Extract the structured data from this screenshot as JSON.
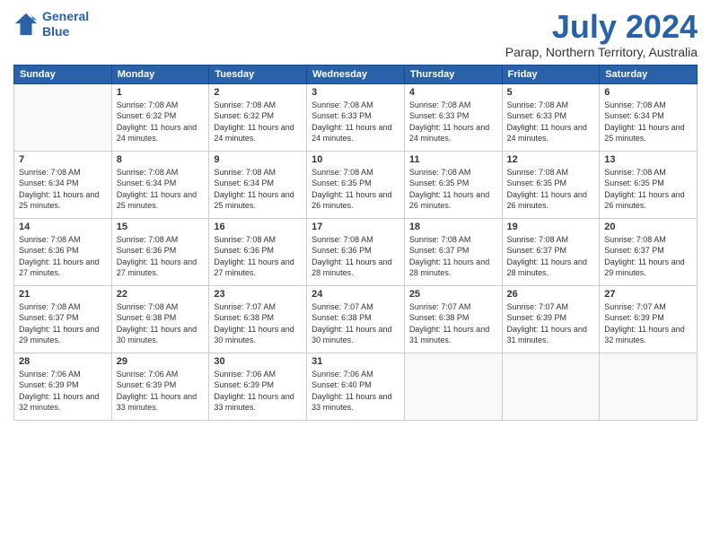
{
  "logo": {
    "line1": "General",
    "line2": "Blue"
  },
  "title": "July 2024",
  "subtitle": "Parap, Northern Territory, Australia",
  "days_header": [
    "Sunday",
    "Monday",
    "Tuesday",
    "Wednesday",
    "Thursday",
    "Friday",
    "Saturday"
  ],
  "weeks": [
    [
      {
        "day": "",
        "sunrise": "",
        "sunset": "",
        "daylight": ""
      },
      {
        "day": "1",
        "sunrise": "Sunrise: 7:08 AM",
        "sunset": "Sunset: 6:32 PM",
        "daylight": "Daylight: 11 hours and 24 minutes."
      },
      {
        "day": "2",
        "sunrise": "Sunrise: 7:08 AM",
        "sunset": "Sunset: 6:32 PM",
        "daylight": "Daylight: 11 hours and 24 minutes."
      },
      {
        "day": "3",
        "sunrise": "Sunrise: 7:08 AM",
        "sunset": "Sunset: 6:33 PM",
        "daylight": "Daylight: 11 hours and 24 minutes."
      },
      {
        "day": "4",
        "sunrise": "Sunrise: 7:08 AM",
        "sunset": "Sunset: 6:33 PM",
        "daylight": "Daylight: 11 hours and 24 minutes."
      },
      {
        "day": "5",
        "sunrise": "Sunrise: 7:08 AM",
        "sunset": "Sunset: 6:33 PM",
        "daylight": "Daylight: 11 hours and 24 minutes."
      },
      {
        "day": "6",
        "sunrise": "Sunrise: 7:08 AM",
        "sunset": "Sunset: 6:34 PM",
        "daylight": "Daylight: 11 hours and 25 minutes."
      }
    ],
    [
      {
        "day": "7",
        "sunrise": "Sunrise: 7:08 AM",
        "sunset": "Sunset: 6:34 PM",
        "daylight": "Daylight: 11 hours and 25 minutes."
      },
      {
        "day": "8",
        "sunrise": "Sunrise: 7:08 AM",
        "sunset": "Sunset: 6:34 PM",
        "daylight": "Daylight: 11 hours and 25 minutes."
      },
      {
        "day": "9",
        "sunrise": "Sunrise: 7:08 AM",
        "sunset": "Sunset: 6:34 PM",
        "daylight": "Daylight: 11 hours and 25 minutes."
      },
      {
        "day": "10",
        "sunrise": "Sunrise: 7:08 AM",
        "sunset": "Sunset: 6:35 PM",
        "daylight": "Daylight: 11 hours and 26 minutes."
      },
      {
        "day": "11",
        "sunrise": "Sunrise: 7:08 AM",
        "sunset": "Sunset: 6:35 PM",
        "daylight": "Daylight: 11 hours and 26 minutes."
      },
      {
        "day": "12",
        "sunrise": "Sunrise: 7:08 AM",
        "sunset": "Sunset: 6:35 PM",
        "daylight": "Daylight: 11 hours and 26 minutes."
      },
      {
        "day": "13",
        "sunrise": "Sunrise: 7:08 AM",
        "sunset": "Sunset: 6:35 PM",
        "daylight": "Daylight: 11 hours and 26 minutes."
      }
    ],
    [
      {
        "day": "14",
        "sunrise": "Sunrise: 7:08 AM",
        "sunset": "Sunset: 6:36 PM",
        "daylight": "Daylight: 11 hours and 27 minutes."
      },
      {
        "day": "15",
        "sunrise": "Sunrise: 7:08 AM",
        "sunset": "Sunset: 6:36 PM",
        "daylight": "Daylight: 11 hours and 27 minutes."
      },
      {
        "day": "16",
        "sunrise": "Sunrise: 7:08 AM",
        "sunset": "Sunset: 6:36 PM",
        "daylight": "Daylight: 11 hours and 27 minutes."
      },
      {
        "day": "17",
        "sunrise": "Sunrise: 7:08 AM",
        "sunset": "Sunset: 6:36 PM",
        "daylight": "Daylight: 11 hours and 28 minutes."
      },
      {
        "day": "18",
        "sunrise": "Sunrise: 7:08 AM",
        "sunset": "Sunset: 6:37 PM",
        "daylight": "Daylight: 11 hours and 28 minutes."
      },
      {
        "day": "19",
        "sunrise": "Sunrise: 7:08 AM",
        "sunset": "Sunset: 6:37 PM",
        "daylight": "Daylight: 11 hours and 28 minutes."
      },
      {
        "day": "20",
        "sunrise": "Sunrise: 7:08 AM",
        "sunset": "Sunset: 6:37 PM",
        "daylight": "Daylight: 11 hours and 29 minutes."
      }
    ],
    [
      {
        "day": "21",
        "sunrise": "Sunrise: 7:08 AM",
        "sunset": "Sunset: 6:37 PM",
        "daylight": "Daylight: 11 hours and 29 minutes."
      },
      {
        "day": "22",
        "sunrise": "Sunrise: 7:08 AM",
        "sunset": "Sunset: 6:38 PM",
        "daylight": "Daylight: 11 hours and 30 minutes."
      },
      {
        "day": "23",
        "sunrise": "Sunrise: 7:07 AM",
        "sunset": "Sunset: 6:38 PM",
        "daylight": "Daylight: 11 hours and 30 minutes."
      },
      {
        "day": "24",
        "sunrise": "Sunrise: 7:07 AM",
        "sunset": "Sunset: 6:38 PM",
        "daylight": "Daylight: 11 hours and 30 minutes."
      },
      {
        "day": "25",
        "sunrise": "Sunrise: 7:07 AM",
        "sunset": "Sunset: 6:38 PM",
        "daylight": "Daylight: 11 hours and 31 minutes."
      },
      {
        "day": "26",
        "sunrise": "Sunrise: 7:07 AM",
        "sunset": "Sunset: 6:39 PM",
        "daylight": "Daylight: 11 hours and 31 minutes."
      },
      {
        "day": "27",
        "sunrise": "Sunrise: 7:07 AM",
        "sunset": "Sunset: 6:39 PM",
        "daylight": "Daylight: 11 hours and 32 minutes."
      }
    ],
    [
      {
        "day": "28",
        "sunrise": "Sunrise: 7:06 AM",
        "sunset": "Sunset: 6:39 PM",
        "daylight": "Daylight: 11 hours and 32 minutes."
      },
      {
        "day": "29",
        "sunrise": "Sunrise: 7:06 AM",
        "sunset": "Sunset: 6:39 PM",
        "daylight": "Daylight: 11 hours and 33 minutes."
      },
      {
        "day": "30",
        "sunrise": "Sunrise: 7:06 AM",
        "sunset": "Sunset: 6:39 PM",
        "daylight": "Daylight: 11 hours and 33 minutes."
      },
      {
        "day": "31",
        "sunrise": "Sunrise: 7:06 AM",
        "sunset": "Sunset: 6:40 PM",
        "daylight": "Daylight: 11 hours and 33 minutes."
      },
      {
        "day": "",
        "sunrise": "",
        "sunset": "",
        "daylight": ""
      },
      {
        "day": "",
        "sunrise": "",
        "sunset": "",
        "daylight": ""
      },
      {
        "day": "",
        "sunrise": "",
        "sunset": "",
        "daylight": ""
      }
    ]
  ]
}
